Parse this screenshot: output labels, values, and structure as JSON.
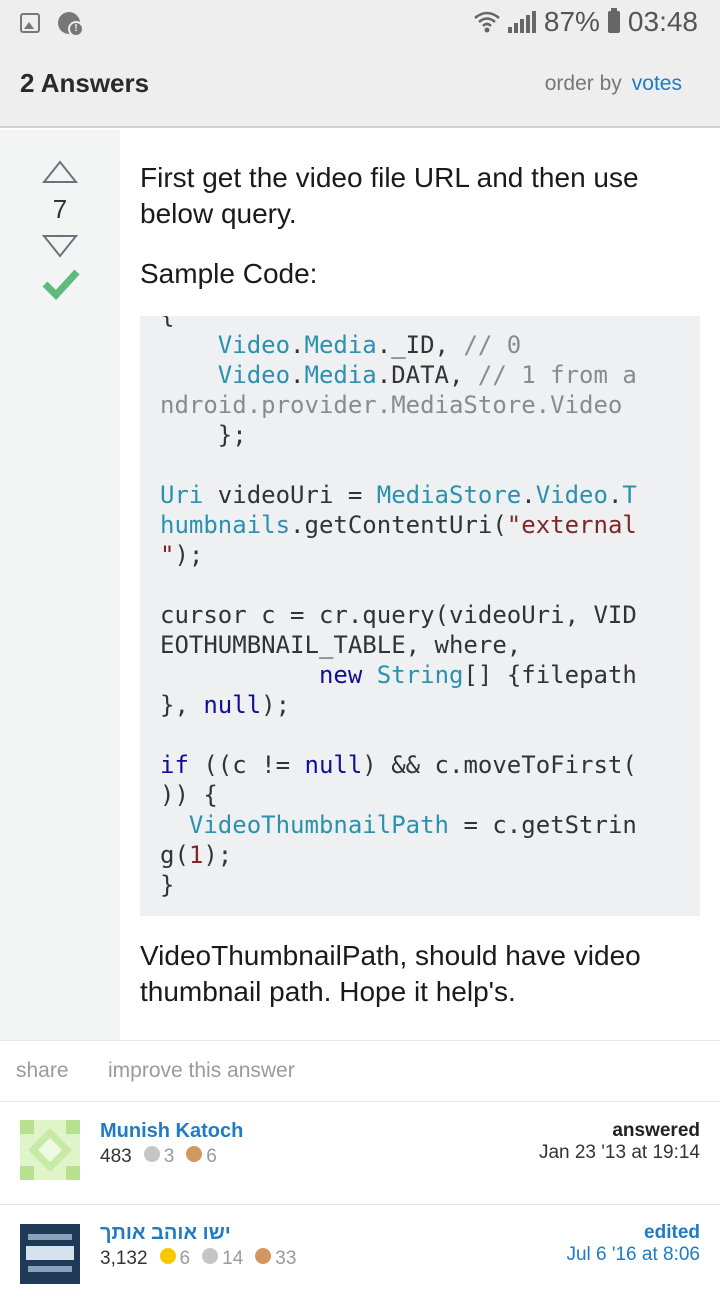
{
  "status_bar": {
    "battery": "87%",
    "time": "03:48",
    "icons": [
      "gallery-icon",
      "alert-icon",
      "wifi-icon",
      "signal-icon",
      "battery-icon"
    ]
  },
  "header": {
    "title": "2 Answers",
    "order_label": "order by",
    "order_value": "votes"
  },
  "answer": {
    "vote_count": "7",
    "accepted": true,
    "intro": "First get the video file URL and then use below query.",
    "sample_label": "Sample Code:",
    "code_lines": [
      "{",
      "    Video.Media._ID, // 0",
      "    Video.Media.DATA, // 1 from a",
      "ndroid.provider.MediaStore.Video",
      "    };",
      "",
      "Uri videoUri = MediaStore.Video.T",
      "humbnails.getContentUri(\"external",
      "\");",
      "",
      "cursor c = cr.query(videoUri, VID",
      "EOTHUMBNAIL_TABLE, where,",
      "           new String[] {filepath",
      "}, null);",
      "",
      "if ((c != null) && c.moveToFirst(",
      ")) {",
      "  VideoThumbnailPath = c.getStrin",
      "g(1);",
      "}"
    ],
    "outro": "VideoThumbnailPath, should have video thumbnail path. Hope it help's."
  },
  "actions": {
    "share": "share",
    "improve": "improve this answer"
  },
  "answered_by": {
    "label": "answered",
    "date": "Jan 23 '13 at 19:14",
    "name": "Munish Katoch",
    "reputation": "483",
    "silver": "3",
    "bronze": "6"
  },
  "edited_by": {
    "label": "edited",
    "date": "Jul 6 '16 at 8:06",
    "name": "ישו אוהב אותך",
    "reputation": "3,132",
    "gold": "6",
    "silver": "14",
    "bronze": "33"
  },
  "colors": {
    "link": "#1e7bc4",
    "accepted": "#5eba7d",
    "code_bg": "#eff0f1",
    "keyword": "#101094",
    "type": "#2b91af",
    "string": "#7d2727",
    "comment": "#858c93"
  }
}
